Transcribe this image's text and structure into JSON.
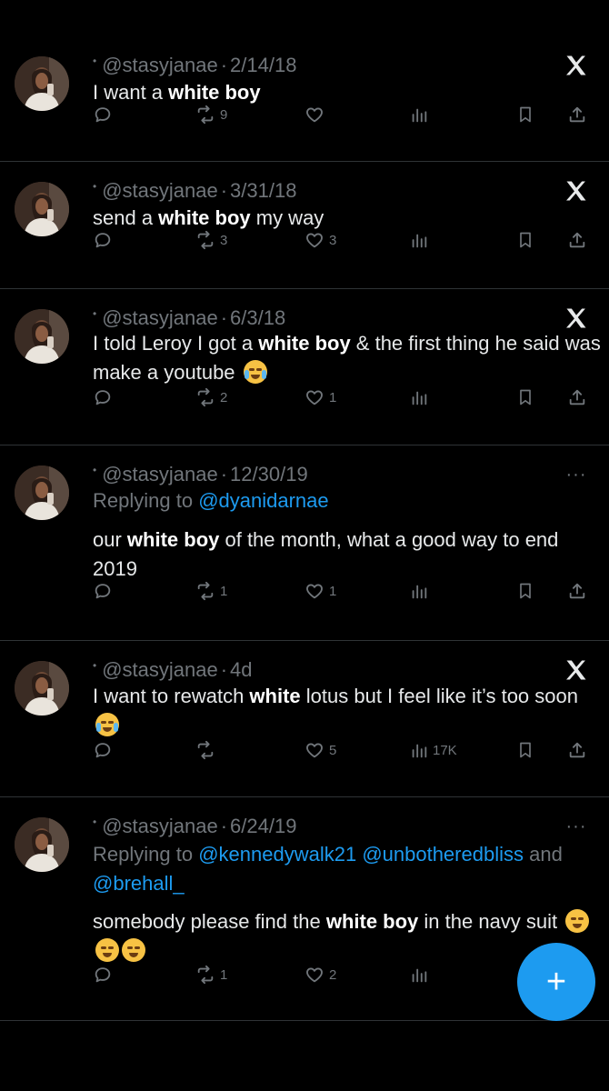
{
  "tweets": [
    {
      "handle": "@stasyjanae",
      "date": "2/14/18",
      "top_icon": "x-logo-icon",
      "reply": null,
      "segments": [
        {
          "t": "I want a "
        },
        {
          "t": "white boy",
          "b": true
        }
      ],
      "stats": {
        "retweets": "9",
        "likes": "",
        "views": ""
      }
    },
    {
      "handle": "@stasyjanae",
      "date": "3/31/18",
      "top_icon": "x-logo-icon",
      "reply": null,
      "segments": [
        {
          "t": "send a "
        },
        {
          "t": "white boy",
          "b": true
        },
        {
          "t": " my way"
        }
      ],
      "stats": {
        "retweets": "3",
        "likes": "3",
        "views": ""
      }
    },
    {
      "handle": "@stasyjanae",
      "date": "6/3/18",
      "top_icon": "x-logo-icon",
      "reply": null,
      "segments": [
        {
          "t": "I told Leroy I got a "
        },
        {
          "t": "white boy",
          "b": true
        },
        {
          "t": " & the first thing he said was make a youtube "
        },
        {
          "emoji": "laugh"
        }
      ],
      "stats": {
        "retweets": "2",
        "likes": "1",
        "views": ""
      }
    },
    {
      "handle": "@stasyjanae",
      "date": "12/30/19",
      "top_icon": "more-icon",
      "reply": {
        "prefix": "Replying to ",
        "mentions": [
          "@dyanidarnae"
        ],
        "joiner": ""
      },
      "segments": [
        {
          "t": "our "
        },
        {
          "t": "white boy",
          "b": true
        },
        {
          "t": " of the month, what a good way to end 2019"
        }
      ],
      "stats": {
        "retweets": "1",
        "likes": "1",
        "views": ""
      }
    },
    {
      "handle": "@stasyjanae",
      "date": "4d",
      "top_icon": "x-logo-icon",
      "reply": null,
      "segments": [
        {
          "t": "I want to rewatch "
        },
        {
          "t": "white",
          "b": true
        },
        {
          "t": " lotus but I feel like it’s too soon "
        },
        {
          "emoji": "cry"
        }
      ],
      "stats": {
        "retweets": "",
        "likes": "5",
        "views": "17K"
      }
    },
    {
      "handle": "@stasyjanae",
      "date": "6/24/19",
      "top_icon": "more-icon",
      "reply": {
        "prefix": "Replying to ",
        "mentions": [
          "@kennedywalk21",
          "@unbotheredbliss",
          "@brehall_"
        ],
        "joiner": "and"
      },
      "segments": [
        {
          "t": "somebody please find the "
        },
        {
          "t": "white boy",
          "b": true
        },
        {
          "t": " in the navy suit "
        },
        {
          "emoji": "pensive"
        },
        {
          "emoji": "pensive"
        },
        {
          "emoji": "pensive"
        }
      ],
      "stats": {
        "retweets": "1",
        "likes": "2",
        "views": ""
      }
    }
  ],
  "compose_button": {
    "label": "+"
  },
  "colors": {
    "accent": "#1d9bf0",
    "muted": "#71767b",
    "bg": "#000000",
    "text": "#e7e9ea"
  }
}
